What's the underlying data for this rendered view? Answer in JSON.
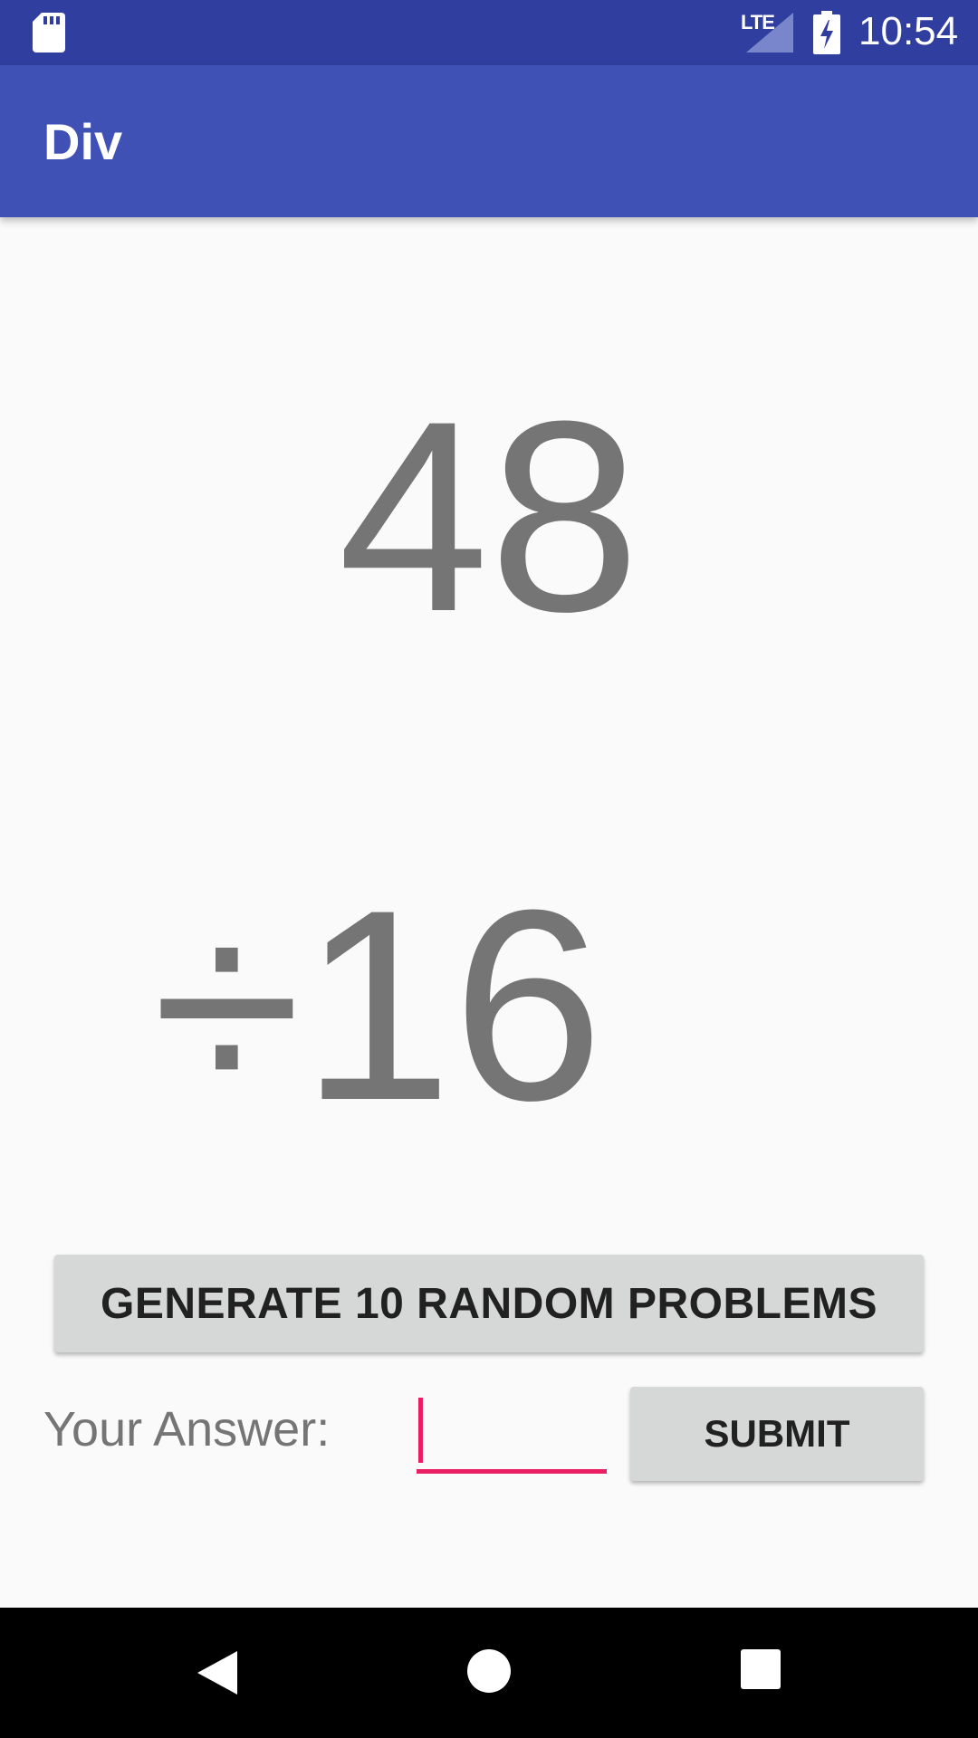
{
  "status_bar": {
    "time": "10:54",
    "network": "LTE",
    "icons": [
      "sd-card-icon",
      "signal-icon",
      "battery-charging-icon"
    ]
  },
  "app_bar": {
    "title": "Div"
  },
  "problem": {
    "dividend": "48",
    "divisor_line": "÷16"
  },
  "actions": {
    "generate_label": "GENERATE 10 RANDOM PROBLEMS",
    "answer_label": "Your Answer:",
    "answer_value": "",
    "submit_label": "SUBMIT"
  },
  "nav_bar": {
    "icons": [
      "back-icon",
      "home-icon",
      "recents-icon"
    ]
  },
  "colors": {
    "status_bar": "#303f9f",
    "app_bar": "#3f51b5",
    "accent": "#e91e63",
    "number_text": "#757575",
    "button_bg": "#d6d7d7"
  }
}
